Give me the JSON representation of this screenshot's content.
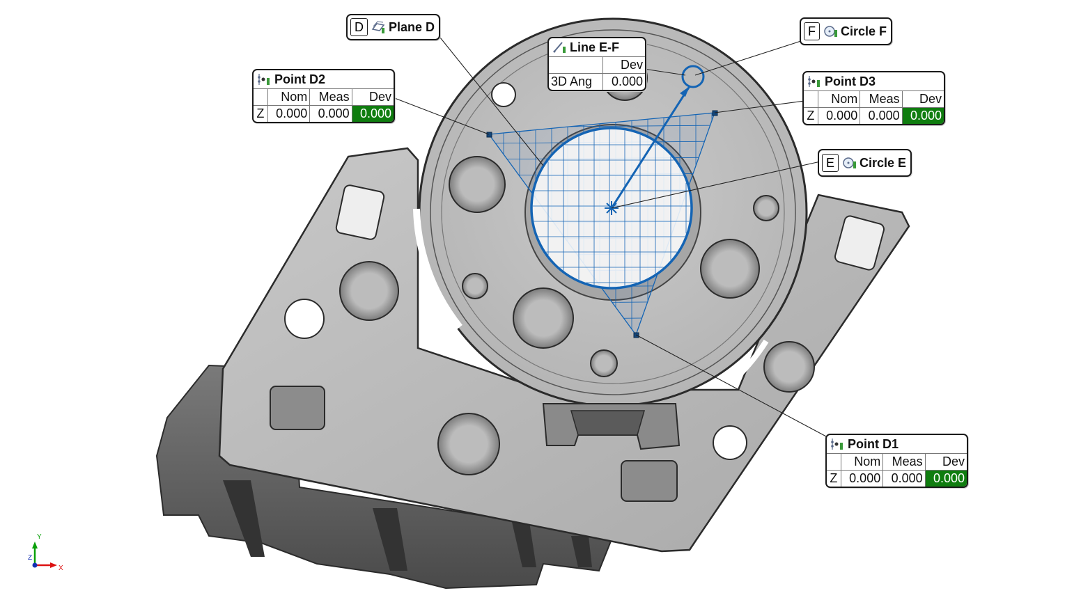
{
  "callouts": {
    "plane_d": {
      "letter": "D",
      "title": "Plane D",
      "icon": "plane-icon"
    },
    "circle_f": {
      "letter": "F",
      "title": "Circle F",
      "icon": "circle-icon"
    },
    "circle_e": {
      "letter": "E",
      "title": "Circle E",
      "icon": "circle-icon"
    },
    "line_ef": {
      "title": "Line E-F",
      "icon": "line-icon",
      "header": "Dev",
      "row_label": "3D Ang",
      "row_value": "0.000"
    },
    "point_d2": {
      "title": "Point D2",
      "icon": "point-icon",
      "headers": [
        "Nom",
        "Meas",
        "Dev"
      ],
      "axis": "Z",
      "nom": "0.000",
      "meas": "0.000",
      "dev": "0.000"
    },
    "point_d3": {
      "title": "Point D3",
      "icon": "point-icon",
      "headers": [
        "Nom",
        "Meas",
        "Dev"
      ],
      "axis": "Z",
      "nom": "0.000",
      "meas": "0.000",
      "dev": "0.000"
    },
    "point_d1": {
      "title": "Point D1",
      "icon": "point-icon",
      "headers": [
        "Nom",
        "Meas",
        "Dev"
      ],
      "axis": "Z",
      "nom": "0.000",
      "meas": "0.000",
      "dev": "0.000"
    }
  },
  "triad": {
    "x_label": "X",
    "y_label": "Y",
    "z_label": "Z"
  },
  "colors": {
    "feature_blue": "#1464b4",
    "dev_ok_green": "#0f7d0f",
    "part_gray": "#bdbdbd"
  }
}
